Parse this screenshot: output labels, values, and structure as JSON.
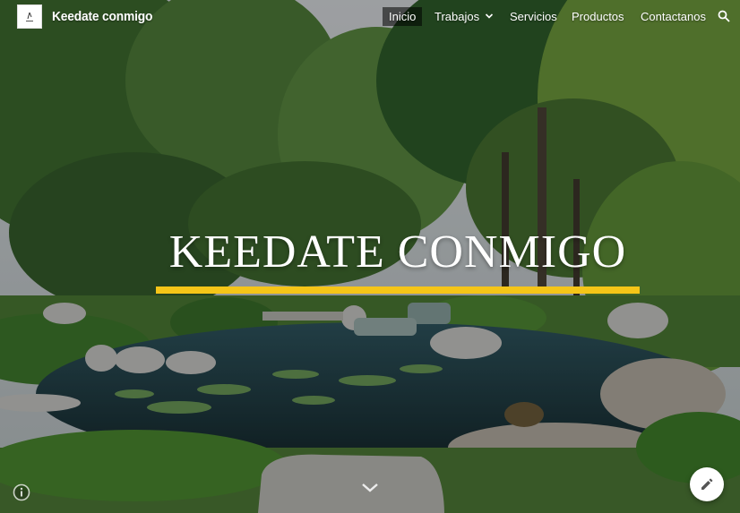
{
  "site": {
    "title": "Keedate conmigo"
  },
  "nav": {
    "items": [
      {
        "label": "Inicio",
        "active": true
      },
      {
        "label": "Trabajos",
        "has_dropdown": true
      },
      {
        "label": "Servicios"
      },
      {
        "label": "Productos"
      },
      {
        "label": "Contactanos"
      }
    ],
    "search_icon": "search-icon"
  },
  "hero": {
    "title": "KEEDATE CONMIGO",
    "accent_color": "#f5c518",
    "scroll_icon": "chevron-down-icon"
  },
  "footer": {
    "info_icon": "info-icon",
    "edit_icon": "pencil-icon"
  }
}
